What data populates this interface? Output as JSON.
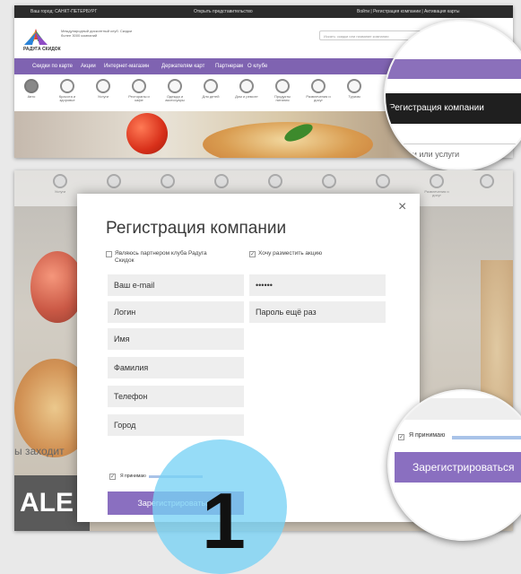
{
  "panel1": {
    "topbar": {
      "left": "Ваш город: САНКТ-ПЕТЕРБУРГ",
      "center": "Открыть представительство",
      "right": "Войти | Регистрация компании | Активация карты"
    },
    "logo": {
      "text": "РАДУГА СКИДОК"
    },
    "tagline": "Международный дисконтный клуб. Скидки более 3000 компаний",
    "search_placeholder": "Искать: скидки или название компании",
    "nav": [
      "Скидки по карте",
      "Акции",
      "Интернет-магазин",
      "Держателям карт",
      "Партнерам",
      "О клубе"
    ],
    "categories": [
      "Авто",
      "Красота и здоровье",
      "Услуги",
      "Рестораны и кафе",
      "Одежда и аксессуары",
      "Для детей",
      "Дом и ремонт",
      "Продукты питания",
      "Развлечения и досуг",
      "Туризм"
    ],
    "mag_tooltip": "Регистрация компании",
    "mag_search": "пании или услуги"
  },
  "modal": {
    "title": "Регистрация компании",
    "close": "×",
    "partner_label": "Являюсь партнером клуба Радуга Скидок",
    "promo_label": "Хочу разместить акцию",
    "fields_left": [
      "Ваш e-mail",
      "Логин",
      "Имя",
      "Фамилия",
      "Телефон",
      "Город"
    ],
    "fields_right": [
      "••••••",
      "Пароль ещё раз"
    ],
    "accept_label": "Я принимаю",
    "register_button": "Зарегистрироваться"
  },
  "background": {
    "text_fragment": "ы заходит",
    "banner_fragment": "ALE"
  },
  "mag2": {
    "city": "род",
    "accept": "Я принимаю",
    "button": "Зарегистрироваться"
  },
  "annotation": {
    "number": "1"
  },
  "colors": {
    "purple": "#8a6fc0",
    "nav": "#7f63b1",
    "dark": "#1f1f1f",
    "field": "#eeeeee",
    "highlight": "#78d2f5"
  }
}
